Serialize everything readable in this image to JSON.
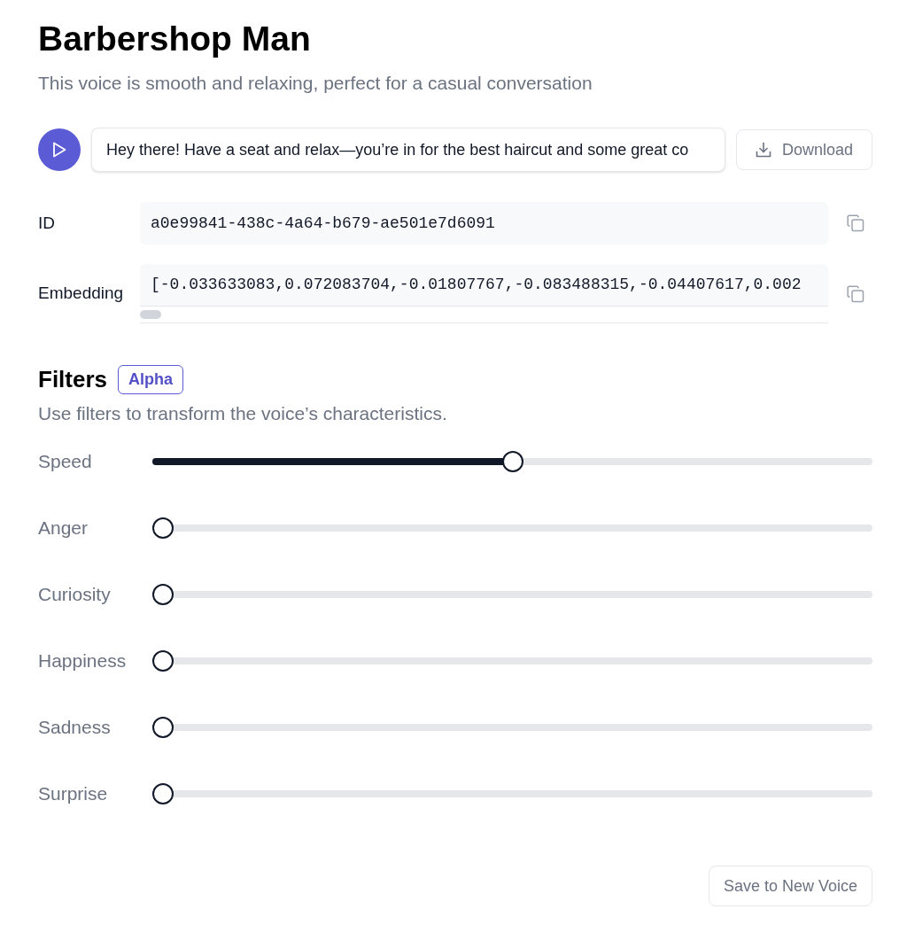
{
  "header": {
    "title": "Barbershop Man",
    "description": "This voice is smooth and relaxing, perfect for a casual conversation"
  },
  "preview": {
    "text": "Hey there! Have a seat and relax—you’re in for the best haircut and some great co",
    "download_label": "Download"
  },
  "details": [
    {
      "label": "ID",
      "value": "a0e99841-438c-4a64-b679-ae501e7d6091",
      "kind": "plain"
    },
    {
      "label": "Embedding",
      "value": "[-0.033633083,0.072083704,-0.01807767,-0.083488315,-0.04407617,0.002",
      "kind": "scroll"
    }
  ],
  "filters": {
    "title": "Filters",
    "badge": "Alpha",
    "description": "Use filters to transform the voice’s characteristics.",
    "sliders": [
      {
        "name": "Speed",
        "level": 0.5
      },
      {
        "name": "Anger",
        "level": 0
      },
      {
        "name": "Curiosity",
        "level": 0
      },
      {
        "name": "Happiness",
        "level": 0
      },
      {
        "name": "Sadness",
        "level": 0
      },
      {
        "name": "Surprise",
        "level": 0
      }
    ]
  },
  "actions": {
    "save_label": "Save to New Voice"
  }
}
